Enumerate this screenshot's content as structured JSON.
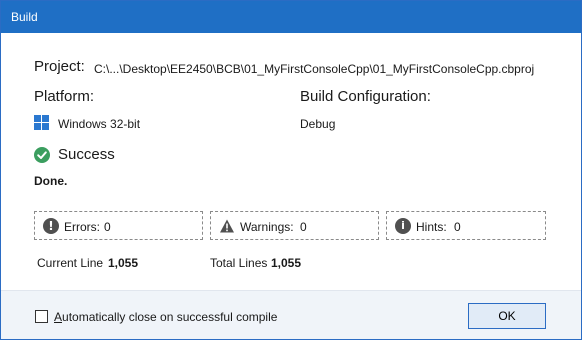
{
  "window": {
    "title": "Build"
  },
  "project": {
    "label": "Project:",
    "path": "C:\\...\\Desktop\\EE2450\\BCB\\01_MyFirstConsoleCpp\\01_MyFirstConsoleCpp.cbproj"
  },
  "platform": {
    "label": "Platform:",
    "value": "Windows 32-bit",
    "icon": "windows-logo-icon"
  },
  "build_config": {
    "label": "Build Configuration:",
    "value": "Debug"
  },
  "status": {
    "text": "Success",
    "icon": "check-circle-icon",
    "color": "#3b9e5f",
    "message": "Done."
  },
  "stats": {
    "errors": {
      "label": "Errors:",
      "value": "0",
      "icon": "error-icon"
    },
    "warnings": {
      "label": "Warnings:",
      "value": "0",
      "icon": "warning-icon"
    },
    "hints": {
      "label": "Hints:",
      "value": "0",
      "icon": "info-icon"
    }
  },
  "lines": {
    "current_label": "Current Line",
    "current_value": "1,055",
    "total_label": "Total Lines",
    "total_value": "1,055"
  },
  "footer": {
    "auto_close_first": "A",
    "auto_close_rest": "utomatically close on successful compile",
    "auto_close_checked": false,
    "ok_label": "OK"
  },
  "colors": {
    "titlebar": "#1f6fc5",
    "accent": "#2a78d0",
    "success": "#3b9e5f"
  }
}
